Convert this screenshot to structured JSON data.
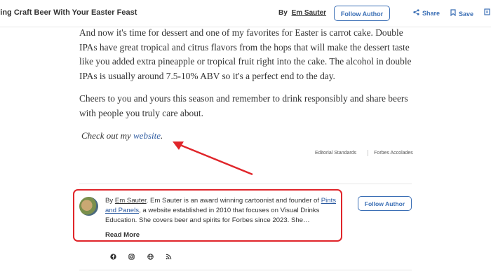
{
  "header": {
    "title": "ring Craft Beer With Your Easter Feast",
    "by_label": "By",
    "author": "Em Sauter",
    "follow_label": "Follow Author",
    "share_label": "Share",
    "save_label": "Save"
  },
  "article": {
    "paragraphs": [
      "And now it's time for dessert and one of my favorites for Easter is carrot cake. Double IPAs have great tropical and citrus flavors from the hops that will make the dessert taste like you added extra pineapple or tropical fruit right into the cake. The alcohol in double IPAs is usually around 7.5-10% ABV so it's a perfect end to the day.",
      "Cheers to you and yours this season and remember to drink responsibly and share beers with people you truly care about."
    ],
    "checkout_prefix": "Check out my ",
    "checkout_link": "website",
    "checkout_suffix": ".",
    "editorial_standards": "Editorial Standards",
    "forbes_accolades": "Forbes Accolades"
  },
  "author_bio": {
    "by_label": "By",
    "author": "Em Sauter",
    "text_1": ". Em Sauter is an award winning cartoonist and founder of ",
    "link": "Pints and Panels",
    "text_2": ", a website established in 2010 that focuses on Visual Drinks Education. She covers beer and spirits for Forbes since 2023. She…",
    "read_more": "Read More",
    "follow_label": "Follow Author"
  },
  "social_icons": [
    "facebook-icon",
    "instagram-icon",
    "website-icon",
    "rss-icon"
  ],
  "annotation": {
    "color": "#e0252a"
  }
}
